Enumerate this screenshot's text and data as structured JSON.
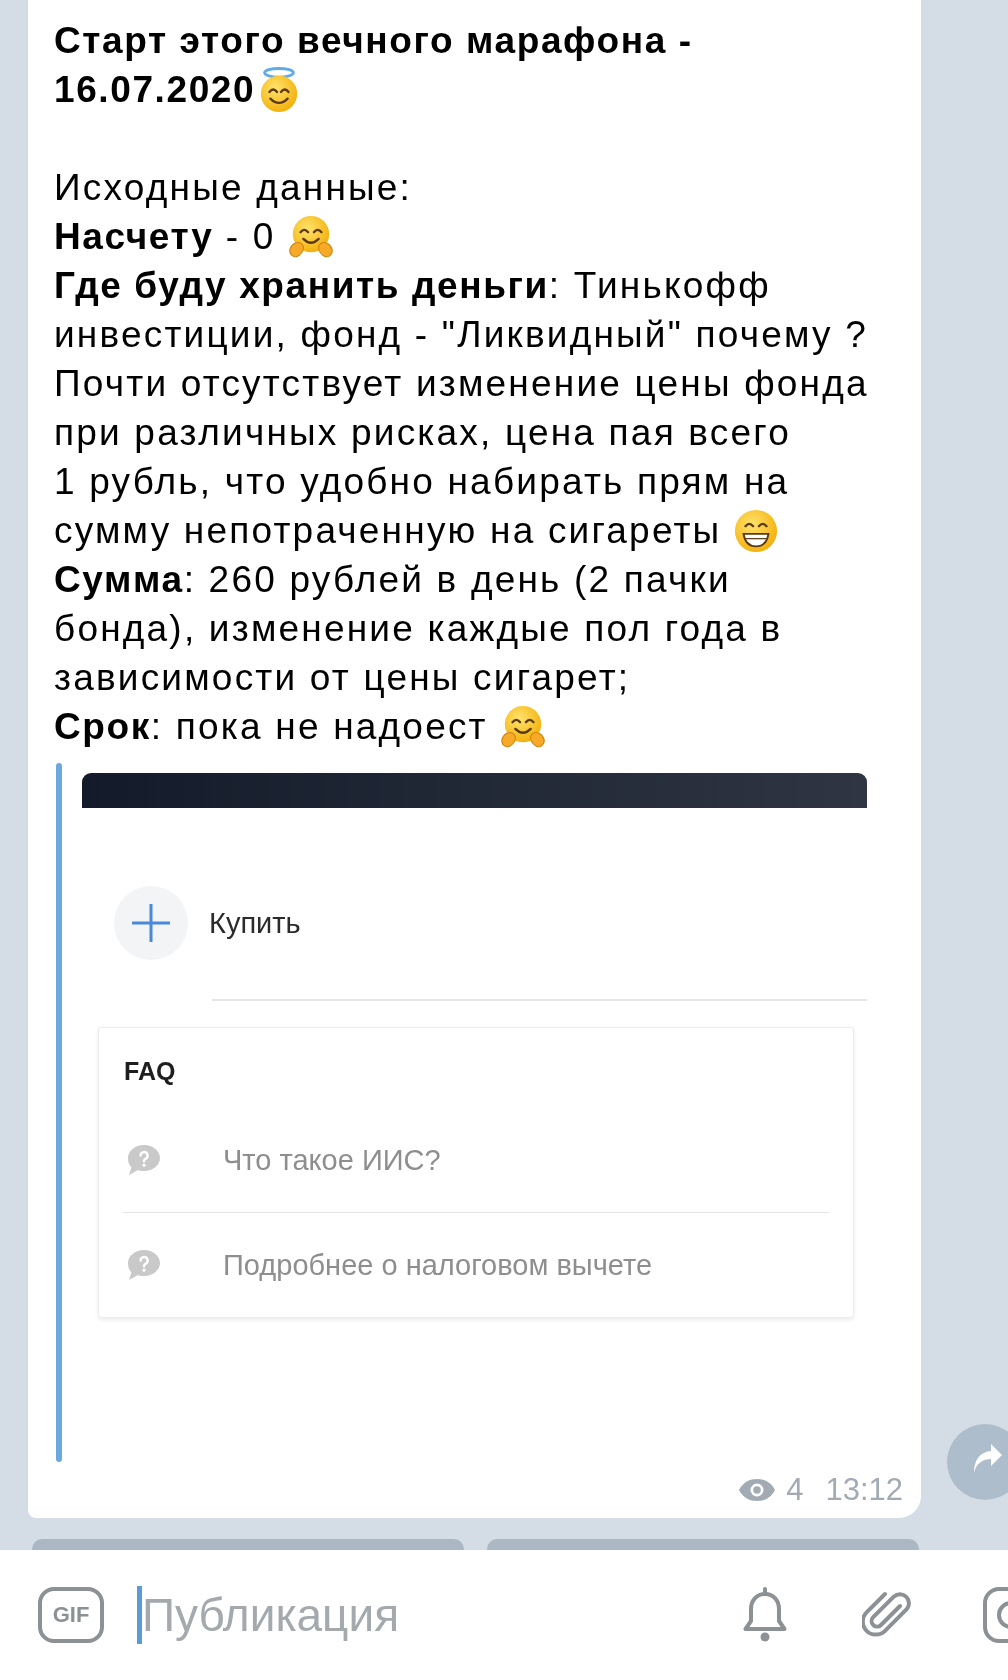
{
  "message": {
    "paragraphs": [
      {
        "kind": "heading",
        "lines": [
          "Старт этого вечного марафона -",
          "16.07.2020"
        ],
        "emoji": {
          "kind": "halo"
        }
      },
      {
        "kind": "plain",
        "lines": [
          "Исходные данные:"
        ]
      },
      {
        "kind": "plain",
        "lines": [
          "**Насчету** - 0"
        ],
        "emoji": {
          "kind": "hug"
        }
      },
      {
        "kind": "plain",
        "lines": [
          "**Где буду хранить деньги**: Тинькофф",
          "инвестиции, фонд - \"Ликвидный\" почему ?",
          "Почти отсутствует изменение цены фонда",
          "при различных рисках, цена пая всего",
          "1 рубль, что удобно набирать прям на",
          "сумму непотраченную на сигареты"
        ],
        "emoji": {
          "kind": "grin"
        }
      },
      {
        "kind": "plain",
        "lines": [
          "**Сумма**: 260 рублей в день (2 пачки",
          "бонда), изменение каждые пол года в",
          "зависимости от цены сигарет;"
        ]
      },
      {
        "kind": "plain",
        "lines": [
          "**Срок**: пока не надоест"
        ],
        "emoji": {
          "kind": "hug"
        }
      }
    ],
    "preview": {
      "action": "Купить",
      "faq": {
        "title": "FAQ",
        "items": [
          "Что такое ИИС?",
          "Подробнее о налоговом вычете"
        ]
      }
    },
    "views": "4",
    "time": "13:12"
  },
  "composer": {
    "gif_label": "GIF",
    "placeholder": "Публикация"
  }
}
